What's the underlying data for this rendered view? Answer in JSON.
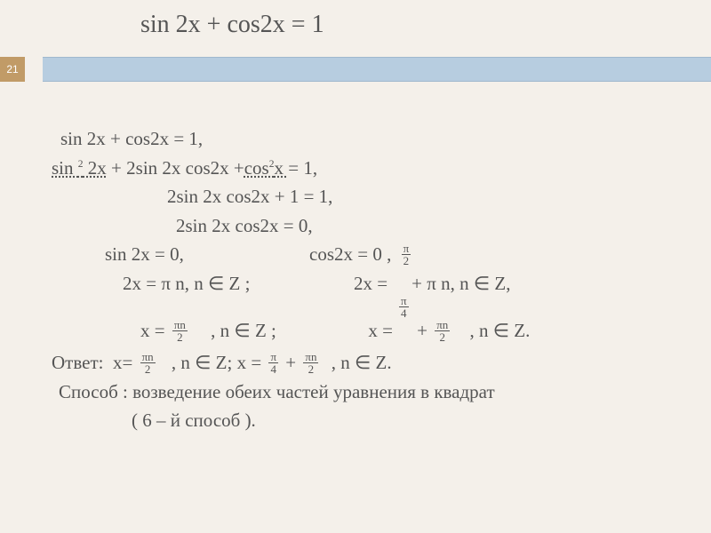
{
  "page_number": "21",
  "title": "sin 2x + cos2x = 1",
  "line1": "sin 2x + cos2x = 1,",
  "line2_a": "sin ",
  "line2_b": " 2x",
  "line2_c": " + 2sin 2x cos2x +",
  "line2_d": "cos",
  "line2_e": "x ",
  "line2_f": "= 1,",
  "line3": "2sin 2x cos2x + 1 =  1,",
  "line4": "2sin 2x cos2x = 0,",
  "line5_a": "sin 2x = 0,",
  "line5_b": "cos2x = 0 ,",
  "line6_a": "2x = π n, n ∈  Z ;",
  "line6_b": "2x =",
  "line6_c": " + π n, n ∈  Z,",
  "line7_a": "x =",
  "line7_b": ", n ∈  Z ;",
  "line7_c": "x  =",
  "line7_d": "+",
  "line7_e": ", n ∈  Z.",
  "answer_label": "Ответ:",
  "ans_a": "x=",
  "ans_b": ", n ∈  Z;  x =",
  "ans_c": "+",
  "ans_d": ", n ∈  Z.",
  "method_a": "Способ : возведение обеих частей уравнения в квадрат",
  "method_b": "( 6 – й способ ).",
  "frac_pi": "π",
  "frac_2": "2",
  "frac_4": "4",
  "frac_pin": "πn",
  "sup2": "2"
}
